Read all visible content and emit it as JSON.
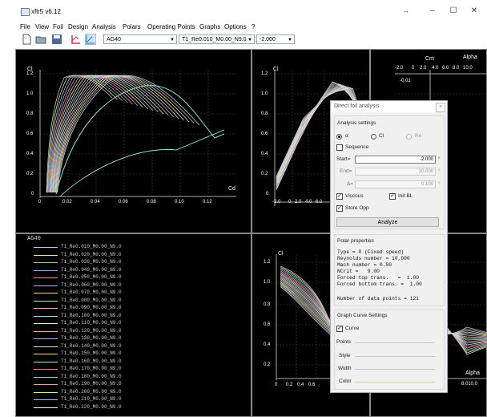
{
  "window": {
    "title": "xflr5 v6.12"
  },
  "menu": [
    "File",
    "View",
    "Foil",
    "Design",
    "Analysis",
    "Polars",
    "Operating Points",
    "Graphs",
    "Options",
    "?"
  ],
  "toolbar": {
    "foil": "AG40",
    "polar": "T1_Re0.010_M0.00_N9.0",
    "alpha": "-2.000"
  },
  "plots": {
    "p1": {
      "ylabel": "Cl",
      "xlabel": "Cd",
      "yticks": [
        "1.2",
        "1.0",
        "0.8",
        "0.6",
        "0.4",
        "0.2",
        "0"
      ],
      "xticks": [
        "0",
        "0.02",
        "0.04",
        "0.06",
        "0.08",
        "0.10",
        "0.12"
      ]
    },
    "p2": {
      "ylabel": "Cl",
      "yticks": [
        "1.2",
        "1.0",
        "0.8",
        "0.6",
        "0.4",
        "0.2",
        "0"
      ],
      "xticks": [
        "-2.0",
        "0",
        "2.0",
        "4.0",
        "6.0"
      ]
    },
    "p3": {
      "ylabel": "Cm",
      "xlabel": "Alpha",
      "xticks": [
        "-2.0",
        "0",
        "2.0",
        "4.0",
        "6.0",
        "8.0",
        "10.0"
      ],
      "ytick": "-0.01"
    },
    "p4": {
      "title": "AG40",
      "series": [
        "T1_Re0.010_M0.00_N9.0",
        "T1_Re0.020_M0.00_N9.0",
        "T1_Re0.030_M0.00_N9.0",
        "T1_Re0.040_M0.00_N9.0",
        "T1_Re0.050_M0.00_N9.0",
        "T1_Re0.060_M0.00_N9.0",
        "T1_Re0.070_M0.00_N9.0",
        "T1_Re0.080_M0.00_N9.0",
        "T1_Re0.090_M0.00_N9.0",
        "T1_Re0.100_M0.00_N9.0",
        "T1_Re0.110_M0.00_N9.0",
        "T1_Re0.120_M0.00_N9.0",
        "T1_Re0.130_M0.00_N9.0",
        "T1_Re0.140_M0.00_N9.0",
        "T1_Re0.150_M0.00_N9.0",
        "T1_Re0.160_M0.00_N9.0",
        "T1_Re0.170_M0.00_N9.0",
        "T1_Re0.180_M0.00_N9.0",
        "T1_Re0.190_M0.00_N9.0",
        "T1_Re0.200_M0.00_N9.0",
        "T1_Re0.210_M0.00_N9.0",
        "T1_Re0.220_M0.00_N9.0"
      ]
    },
    "p5": {
      "ylabel": "Cl",
      "yticks": [
        "1.2",
        "1.0",
        "0.8",
        "0.6",
        "0.4",
        "0.2"
      ],
      "xticks": [
        "0",
        "0.2",
        "0.4",
        "0.6"
      ]
    },
    "p6": {
      "xlabel": "Alpha",
      "xtick": "8.010.0"
    }
  },
  "series_colors": [
    "#c8c8c8",
    "#e6e6a0",
    "#8fd08f",
    "#7fb3ff",
    "#ff8a8a",
    "#d7a0ff",
    "#ffd27a",
    "#a0ffd0",
    "#ff9fe0",
    "#9fe0ff",
    "#d0ff9f",
    "#ffb09f",
    "#b0b0ff",
    "#e0e0e0",
    "#ffe08a",
    "#9fffb0",
    "#ff7fb0",
    "#8fdfff",
    "#e0a0a0",
    "#c0ff80",
    "#a0c0ff",
    "#ffffff"
  ],
  "dialog": {
    "title": "Direct foil analysis",
    "analysis_settings": "Analysis settings",
    "opt_alpha": "α",
    "opt_cl": "Cl",
    "opt_re": "Re",
    "sequence": "Sequence",
    "start_label": "Start=",
    "start_value": "-2.000",
    "end_label": "End=",
    "end_value": "10.000",
    "delta_label": "Δ=",
    "delta_value": "0.100",
    "deg": "°",
    "viscous": "Viscous",
    "init_bl": "Init BL",
    "store_opp": "Store Opp",
    "analyze": "Analyze",
    "polar_properties": "Polar properties",
    "props": [
      "Type = 0 (Fixed speed)",
      "Reynolds number = 10,000",
      "Mach number = 0.00",
      "NCrit =   9.00",
      "Forced top trans.   =  1.00",
      "Forced bottom trans. =  1.00"
    ],
    "data_points": "Number of data points = 121",
    "graph_settings": "Graph Curve Settings",
    "curve": "Curve",
    "points": "Points",
    "style": "Style",
    "width": "Width",
    "color": "Color"
  }
}
